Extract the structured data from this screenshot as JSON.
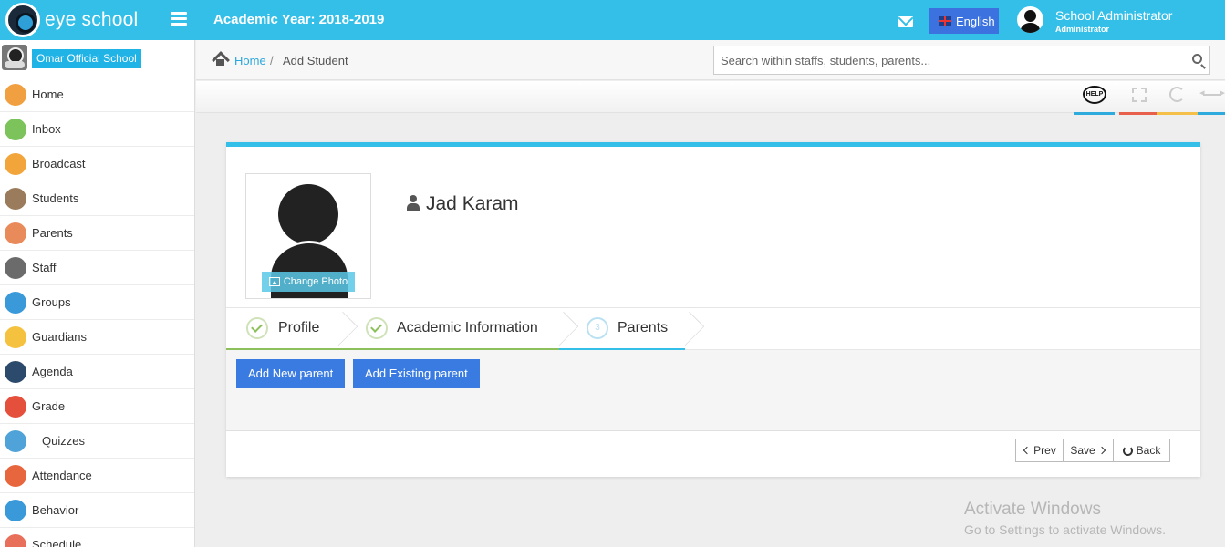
{
  "topbar": {
    "brand": "eye school",
    "academic_year": "Academic Year: 2018-2019",
    "language": "English",
    "user_name": "School Administrator",
    "user_role": "Administrator"
  },
  "sidebar": {
    "school_name": "Omar Official School",
    "items": [
      {
        "label": "Home",
        "icon": "home-icon",
        "color": "#f0a040"
      },
      {
        "label": "Inbox",
        "icon": "inbox-icon",
        "color": "#7cc35b"
      },
      {
        "label": "Broadcast",
        "icon": "broadcast-icon",
        "color": "#f2a53a"
      },
      {
        "label": "Students",
        "icon": "students-icon",
        "color": "#9a7b5b"
      },
      {
        "label": "Parents",
        "icon": "parents-icon",
        "color": "#e98a5a"
      },
      {
        "label": "Staff",
        "icon": "staff-icon",
        "color": "#6b6b6b"
      },
      {
        "label": "Groups",
        "icon": "groups-icon",
        "color": "#3a9ad9"
      },
      {
        "label": "Guardians",
        "icon": "guardians-icon",
        "color": "#f5c240"
      },
      {
        "label": "Agenda",
        "icon": "agenda-icon",
        "color": "#2c4a6b"
      },
      {
        "label": "Grade",
        "icon": "grade-icon",
        "color": "#e4503c"
      },
      {
        "label": "Quizzes",
        "icon": "quizzes-icon",
        "color": "#4fa3d8"
      },
      {
        "label": "Attendance",
        "icon": "attendance-icon",
        "color": "#e8663d"
      },
      {
        "label": "Behavior",
        "icon": "behavior-icon",
        "color": "#3a9ad9"
      },
      {
        "label": "Schedule",
        "icon": "schedule-icon",
        "color": "#e86f5a"
      }
    ]
  },
  "breadcrumb": {
    "home": "Home",
    "separator": "/",
    "current": "Add Student"
  },
  "search": {
    "placeholder": "Search within staffs, students, parents..."
  },
  "toolbar": {
    "help_label": "HELP",
    "bar_colors": [
      "#2eaadc",
      "#e8604c",
      "#f5c04a",
      "#2eaadc"
    ]
  },
  "student": {
    "name": "Jad Karam",
    "change_photo": "Change Photo"
  },
  "wizard": {
    "steps": [
      {
        "label": "Profile",
        "state": "done"
      },
      {
        "label": "Academic Information",
        "state": "done"
      },
      {
        "label": "Parents",
        "number": "3",
        "state": "active"
      }
    ]
  },
  "actions": {
    "add_new": "Add New parent",
    "add_existing": "Add Existing parent"
  },
  "pager": {
    "prev": "Prev",
    "save": "Save",
    "back": "Back"
  },
  "watermark": {
    "title": "Activate Windows",
    "subtitle": "Go to Settings to activate Windows."
  }
}
